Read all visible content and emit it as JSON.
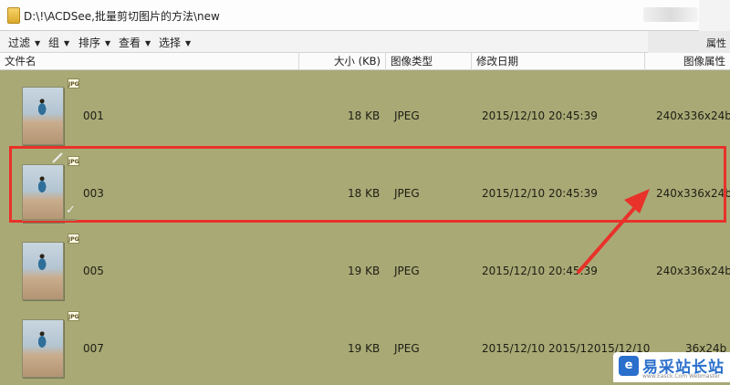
{
  "pathbar": {
    "path": "D:\\!\\ACDSee,批量剪切图片的方法\\new"
  },
  "toolbar": {
    "filter": "过滤",
    "group": "组",
    "sort": "排序",
    "view": "查看",
    "select": "选择",
    "properties": "属性"
  },
  "columns": {
    "filename": "文件名",
    "size": "大小 (KB)",
    "type": "图像类型",
    "modified": "修改日期",
    "attributes": "图像属性"
  },
  "files": [
    {
      "name": "001",
      "size": "18 KB",
      "type": "JPEG",
      "date": "2015/12/10 20:45:39",
      "attributes": "240x336x24b",
      "badge": "JPG"
    },
    {
      "name": "003",
      "size": "18 KB",
      "type": "JPEG",
      "date": "2015/12/10 20:45:39",
      "attributes": "240x336x24b",
      "badge": "JPG"
    },
    {
      "name": "005",
      "size": "19 KB",
      "type": "JPEG",
      "date": "2015/12/10 20:45:39",
      "attributes": "240x336x24b",
      "badge": "JPG"
    },
    {
      "name": "007",
      "size": "19 KB",
      "type": "JPEG",
      "date": "2015/12/10 2015/12015/12/10",
      "attributes": "36x24b",
      "badge": "JPG"
    }
  ],
  "watermark": {
    "logo": "e",
    "text": "易采站长站",
    "url": "www.Easck.Com Webmaster"
  },
  "colors": {
    "background": "#a9a976",
    "selection": "#e8322a"
  }
}
